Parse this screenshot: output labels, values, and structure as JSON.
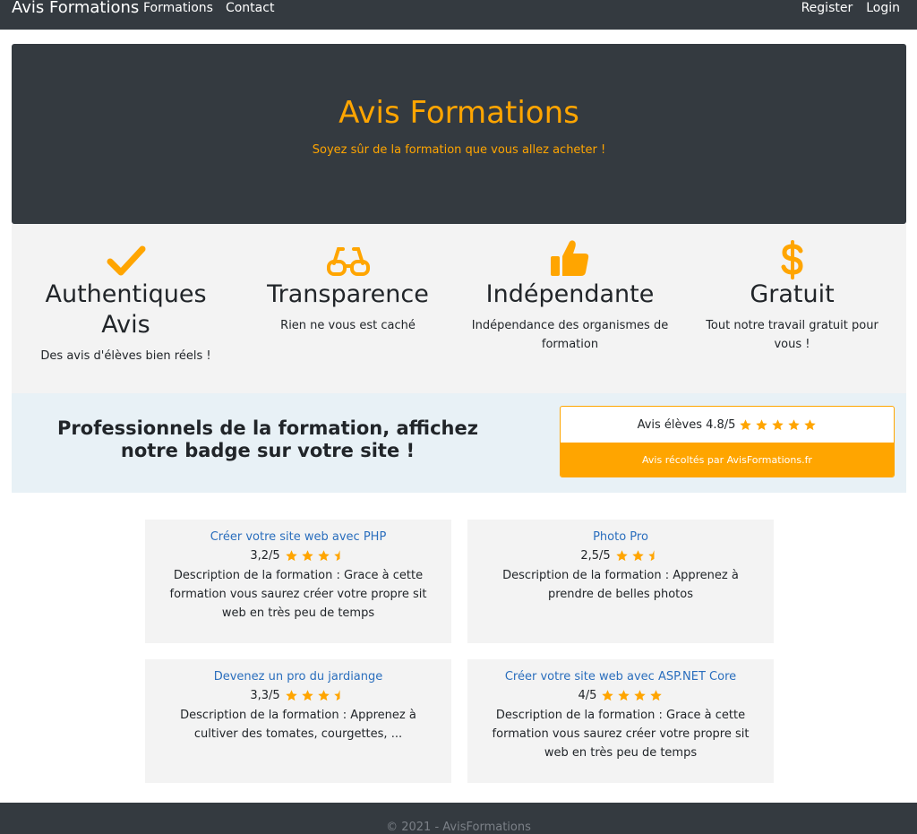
{
  "navbar": {
    "brand": "Avis Formations",
    "left_links": [
      "Formations",
      "Contact"
    ],
    "right_links": [
      "Register",
      "Login"
    ]
  },
  "hero": {
    "title": "Avis Formations",
    "subtitle": "Soyez sûr de la formation que vous allez acheter !"
  },
  "features": [
    {
      "icon": "checkmark-icon",
      "title": "Authentiques Avis",
      "text": "Des avis d'élèves bien réels !"
    },
    {
      "icon": "glasses-icon",
      "title": "Transparence",
      "text": "Rien ne vous est caché"
    },
    {
      "icon": "thumbs-up-icon",
      "title": "Indépendante",
      "text": "Indépendance des organismes de formation"
    },
    {
      "icon": "dollar-icon",
      "title": "Gratuit",
      "text": "Tout notre travail gratuit pour vous !"
    }
  ],
  "badge_section": {
    "text": "Professionnels de la formation, affichez notre badge sur votre site !",
    "badge_label": "Avis élèves 4.8/5",
    "badge_rating": 5,
    "badge_footer": "Avis récoltés par AvisFormations.fr"
  },
  "formations": [
    {
      "title": "Créer votre site web avec PHP",
      "rating_text": "3,2/5",
      "rating": 3.5,
      "description": "Description de la formation : Grace à cette formation vous saurez créer votre propre sit web en très peu de temps"
    },
    {
      "title": "Photo Pro",
      "rating_text": "2,5/5",
      "rating": 2.5,
      "description": "Description de la formation : Apprenez à prendre de belles photos"
    },
    {
      "title": "Devenez un pro du jardiange",
      "rating_text": "3,3/5",
      "rating": 3.5,
      "description": "Description de la formation : Apprenez à cultiver des tomates, courgettes, ..."
    },
    {
      "title": "Créer votre site web avec ASP.NET Core",
      "rating_text": "4/5",
      "rating": 4,
      "description": "Description de la formation : Grace à cette formation vous saurez créer votre propre sit web en très peu de temps"
    }
  ],
  "footer": {
    "text": "© 2021 - AvisFormations"
  },
  "colors": {
    "accent": "#ffa500",
    "dark": "#343a40",
    "link": "#2a6ebd",
    "light_bg": "#f3f3f3",
    "badge_bg": "#e8f1f6"
  }
}
